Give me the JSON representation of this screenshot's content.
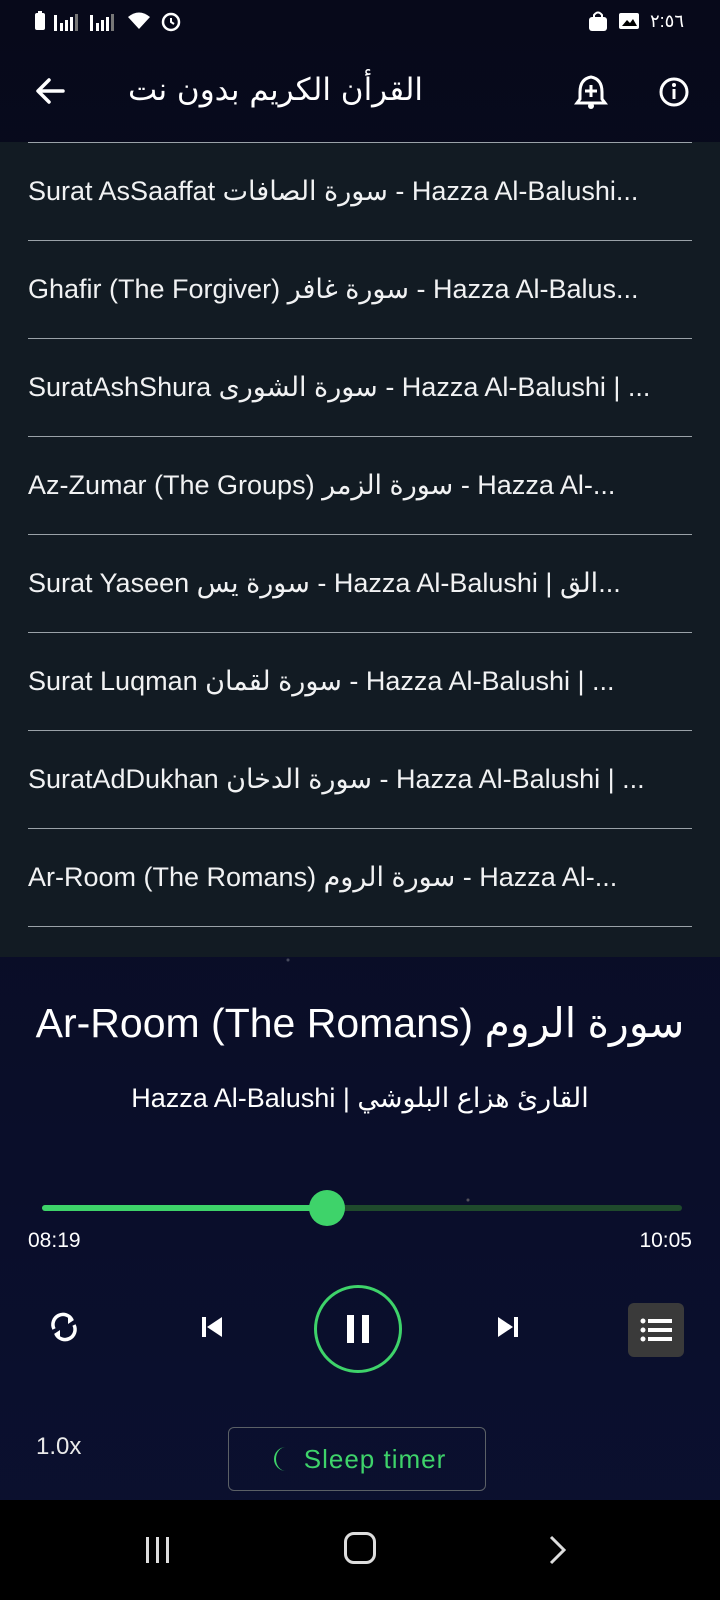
{
  "status_bar": {
    "time": "٢:٥٦"
  },
  "app_bar": {
    "title": "القرأن الكريم بدون نت"
  },
  "list": {
    "items": [
      {
        "label": "Surat AsSaaffat سورة الصافات - Hazza Al-Balushi..."
      },
      {
        "label": "Ghafir (The Forgiver) سورة غافر - Hazza Al-Balus..."
      },
      {
        "label": "SuratAshShura سورة الشورى - Hazza Al-Balushi | ..."
      },
      {
        "label": "Az-Zumar (The Groups) سورة الزمر - Hazza Al-..."
      },
      {
        "label": "Surat Yaseen سورة يس - Hazza Al-Balushi | الق..."
      },
      {
        "label": "Surat Luqman سورة لقمان - Hazza Al-Balushi | ..."
      },
      {
        "label": "SuratAdDukhan سورة الدخان - Hazza Al-Balushi | ..."
      },
      {
        "label": "Ar-Room (The Romans) سورة الروم - Hazza Al-..."
      }
    ]
  },
  "player": {
    "title": "Ar-Room (The Romans) سورة الروم",
    "artist": "Hazza Al-Balushi | القارئ هزاع البلوشي",
    "current_time": "08:19",
    "total_time": "10:05",
    "progress": 0.445,
    "speed": "1.0x",
    "sleep_timer_label": "Sleep timer",
    "accent_color": "#3ed36a"
  }
}
